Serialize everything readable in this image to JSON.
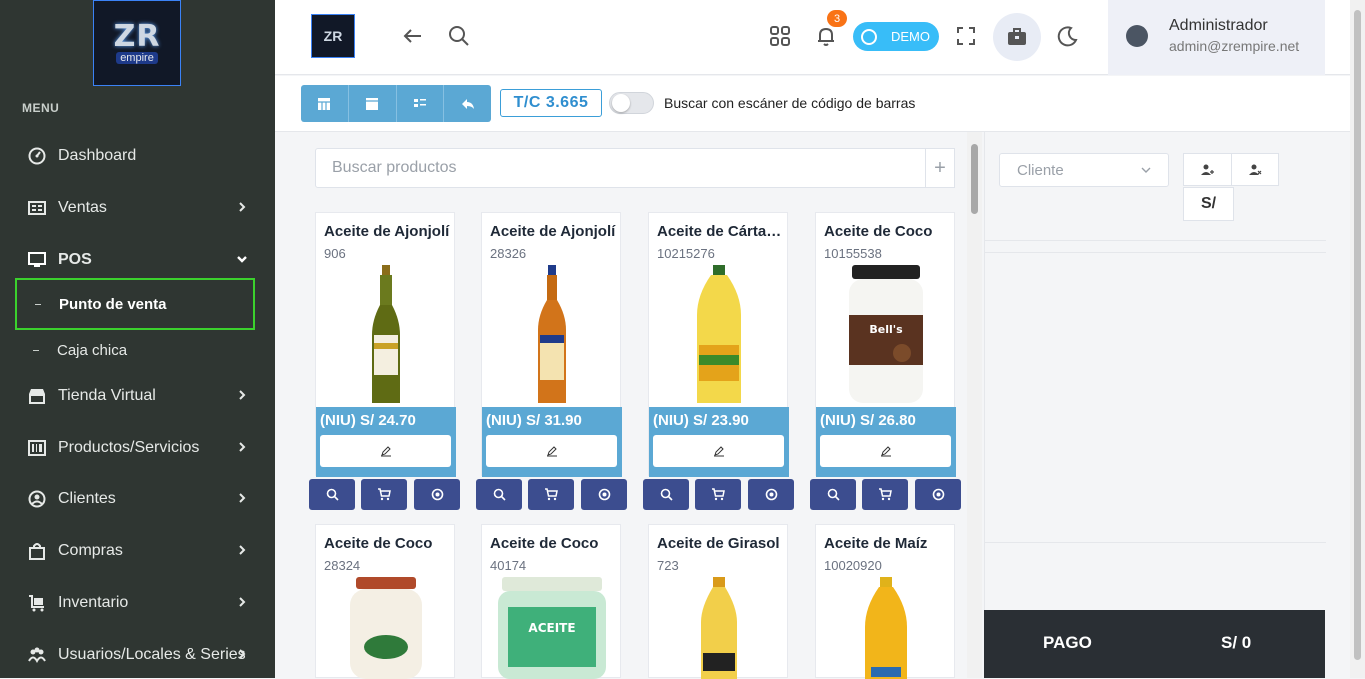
{
  "sidebar": {
    "logo_text": "ZR",
    "logo_sub": "empire",
    "menu_title": "MENU",
    "items": [
      {
        "label": "Dashboard",
        "icon": "dashboard-icon"
      },
      {
        "label": "Ventas",
        "icon": "receipt-icon"
      },
      {
        "label": "POS",
        "icon": "monitor-icon"
      },
      {
        "label": "Tienda Virtual",
        "icon": "store-icon"
      },
      {
        "label": "Productos/Servicios",
        "icon": "barcode-icon"
      },
      {
        "label": "Clientes",
        "icon": "user-circle-icon"
      },
      {
        "label": "Compras",
        "icon": "shopping-bag-icon"
      },
      {
        "label": "Inventario",
        "icon": "cart-icon"
      },
      {
        "label": "Usuarios/Locales & Series",
        "icon": "users-icon"
      }
    ],
    "pos_sub": [
      {
        "label": "Punto de venta",
        "active": true
      },
      {
        "label": "Caja chica",
        "active": false
      }
    ]
  },
  "topbar": {
    "notifications_count": "3",
    "demo_label": "DEMO",
    "user_name": "Administrador",
    "user_email": "admin@zrempire.net"
  },
  "toolbar": {
    "exchange_rate": "T/C 3.665",
    "scanner_label": "Buscar con escáner de código de barras"
  },
  "search": {
    "placeholder": "Buscar productos",
    "add_label": "+"
  },
  "products": [
    {
      "name": "Aceite de Ajonjolí",
      "code": "906",
      "price": "(NIU) S/ 24.70"
    },
    {
      "name": "Aceite de Ajonjolí",
      "code": "28326",
      "price": "(NIU) S/ 31.90"
    },
    {
      "name": "Aceite de Cártamo",
      "code": "10215276",
      "price": "(NIU) S/ 23.90"
    },
    {
      "name": "Aceite de Coco",
      "code": "10155538",
      "price": "(NIU) S/ 26.80"
    },
    {
      "name": "Aceite de Coco",
      "code": "28324",
      "price": ""
    },
    {
      "name": "Aceite de Coco",
      "code": "40174",
      "price": ""
    },
    {
      "name": "Aceite de Girasol",
      "code": "723",
      "price": ""
    },
    {
      "name": "Aceite de Maíz",
      "code": "10020920",
      "price": ""
    }
  ],
  "panel": {
    "cliente_placeholder": "Cliente",
    "currency_label": "S/",
    "pago_label": "PAGO",
    "total_label": "S/ 0"
  },
  "colors": {
    "sidebar_bg": "#2f3632",
    "accent_blue": "#5ba8d4",
    "action_navy": "#3c4d8f",
    "active_border": "#3bd12d",
    "pago_bg": "#2a2f34"
  }
}
